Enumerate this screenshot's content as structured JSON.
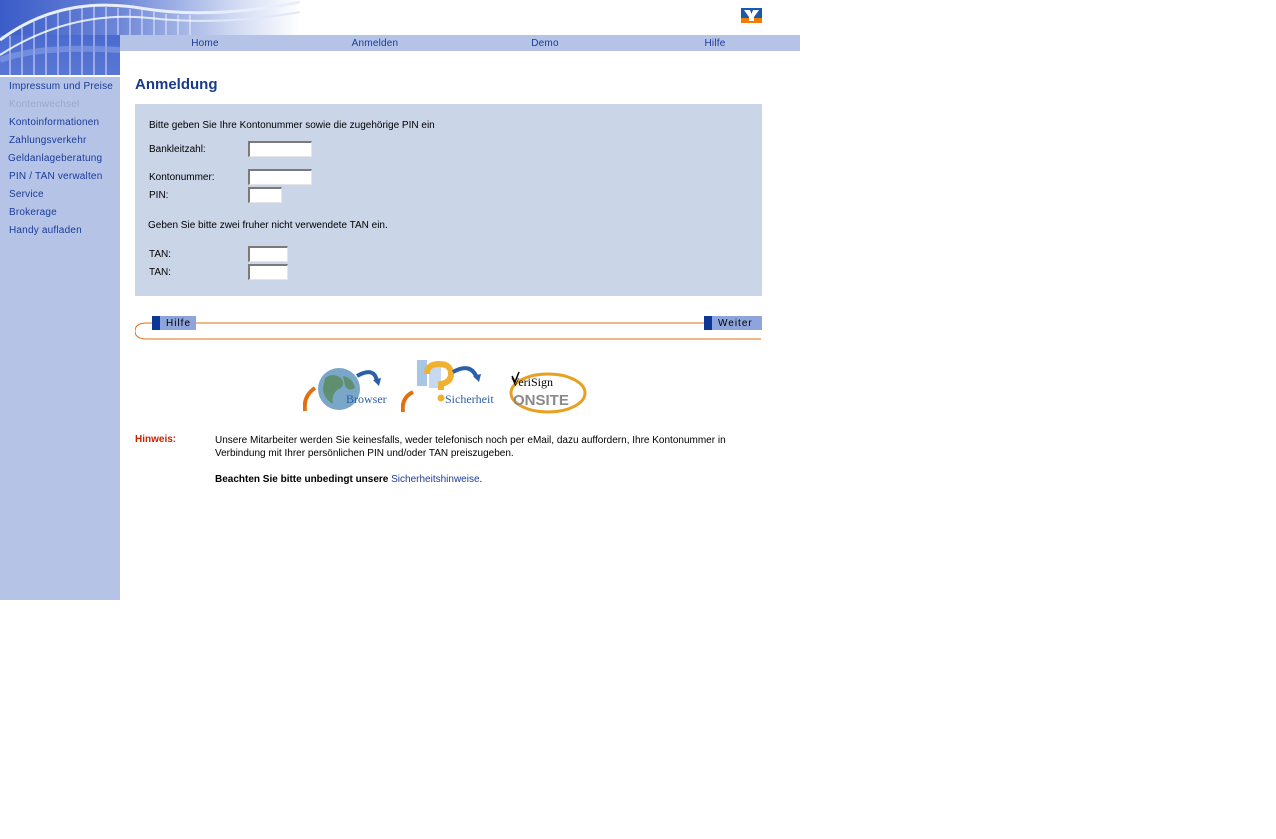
{
  "nav": {
    "items": [
      "Home",
      "Anmelden",
      "Demo",
      "Hilfe"
    ]
  },
  "sidebar": {
    "items": [
      {
        "label": "Impressum und Preise",
        "enabled": true
      },
      {
        "label": "Kontenwechsel",
        "enabled": false
      },
      {
        "label": "Kontoinformationen",
        "enabled": true
      },
      {
        "label": "Zahlungsverkehr",
        "enabled": true
      },
      {
        "label": "Geldanlageberatung",
        "enabled": true
      },
      {
        "label": "PIN / TAN verwalten",
        "enabled": true
      },
      {
        "label": "Service",
        "enabled": true
      },
      {
        "label": "Brokerage",
        "enabled": true
      },
      {
        "label": "Handy aufladen",
        "enabled": true
      }
    ]
  },
  "page": {
    "title": "Anmeldung"
  },
  "form": {
    "intro": "Bitte geben Sie Ihre Kontonummer sowie die zugehörige PIN ein",
    "blz_label": "Bankleitzahl:",
    "blz_value": "",
    "konto_label": "Kontonummer:",
    "konto_value": "",
    "pin_label": "PIN:",
    "pin_value": "",
    "tan_intro": "Geben Sie bitte zwei fruher nicht verwendete TAN ein.",
    "tan1_label": "TAN:",
    "tan1_value": "",
    "tan2_label": "TAN:",
    "tan2_value": ""
  },
  "buttons": {
    "help": "Hilfe",
    "next": "Weiter"
  },
  "badges": {
    "browser": "Browser",
    "security": "Sicherheit",
    "verisign_1": "VeriSign",
    "verisign_2": "ONSITE"
  },
  "note": {
    "label": "Hinweis:",
    "text": "Unsere Mitarbeiter werden Sie keinesfalls, weder telefonisch noch per eMail, dazu auffordern, Ihre Kontonummer in Verbindung mit Ihrer persönlichen PIN und/oder TAN preiszugeben.",
    "bold": "Beachten Sie bitte unbedingt unsere",
    "link": "Sicherheitshinweise",
    "suffix": "."
  },
  "colors": {
    "nav_bg": "#b5c4e6",
    "form_bg": "#cbd5e8",
    "link": "#1a3a9a",
    "accent_orange": "#e07010",
    "hint_red": "#cc2200"
  }
}
